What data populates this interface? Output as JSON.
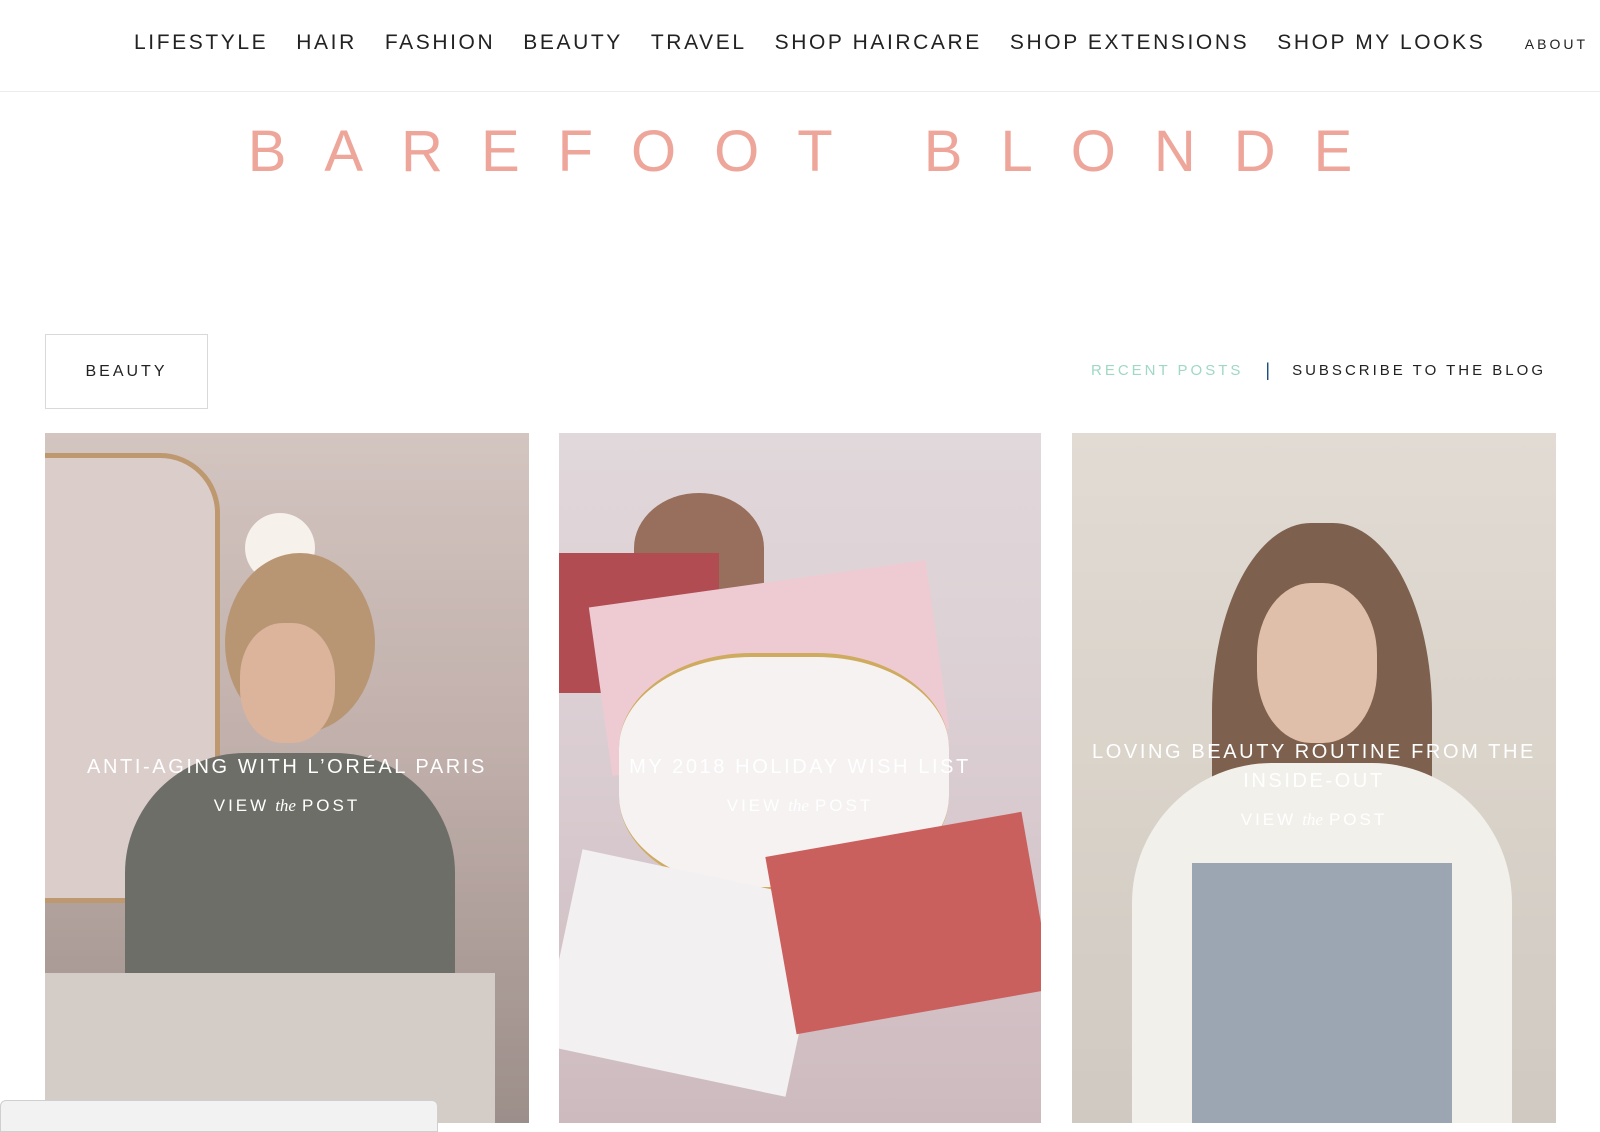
{
  "nav": {
    "items": [
      "LIFESTYLE",
      "HAIR",
      "FASHION",
      "BEAUTY",
      "TRAVEL",
      "SHOP HAIRCARE",
      "SHOP EXTENSIONS",
      "SHOP MY LOOKS"
    ],
    "about": "ABOUT"
  },
  "logo": {
    "text": "BAREFOOT BLONDE",
    "color": "#eea69a"
  },
  "category": {
    "label": "BEAUTY"
  },
  "links": {
    "recent_posts": "RECENT POSTS",
    "separator": "|",
    "subscribe": "SUBSCRIBE TO THE BLOG",
    "recent_color": "#9fd8c3"
  },
  "posts": [
    {
      "title": "ANTI-AGING WITH L’ORÉAL PARIS",
      "view_pre": "VIEW",
      "view_the": "the",
      "view_post": "POST"
    },
    {
      "title": "MY 2018 HOLIDAY WISH LIST",
      "view_pre": "VIEW",
      "view_the": "the",
      "view_post": "POST"
    },
    {
      "title": "LOVING BEAUTY ROUTINE FROM THE INSIDE-OUT",
      "view_pre": "VIEW",
      "view_the": "the",
      "view_post": "POST"
    }
  ]
}
